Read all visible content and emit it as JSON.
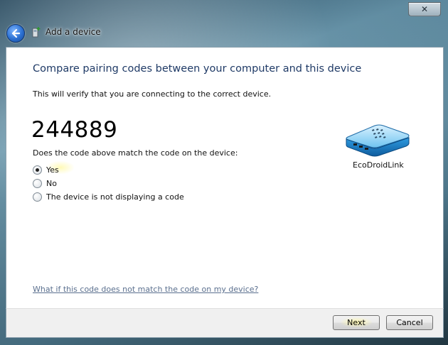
{
  "window": {
    "title": "Add a device",
    "close_glyph": "✕"
  },
  "page": {
    "heading": "Compare pairing codes between your computer and this device",
    "subtext": "This will verify that you are connecting to the correct device.",
    "pairing_code": "244889",
    "question": "Does the code above match the code on the device:",
    "options": [
      {
        "label": "Yes",
        "selected": true
      },
      {
        "label": "No",
        "selected": false
      },
      {
        "label": "The device is not displaying a code",
        "selected": false
      }
    ],
    "device_name": "EcoDroidLink",
    "help_link": "What if this code does not match the code on my device?"
  },
  "footer": {
    "next_label": "Next",
    "cancel_label": "Cancel"
  },
  "icons": {
    "back": "back-arrow-icon",
    "title": "add-device-icon",
    "device": "modem-device-icon"
  },
  "colors": {
    "heading": "#1f3a66",
    "link": "#5a6f8e",
    "back_button": "#2a6fd1"
  }
}
